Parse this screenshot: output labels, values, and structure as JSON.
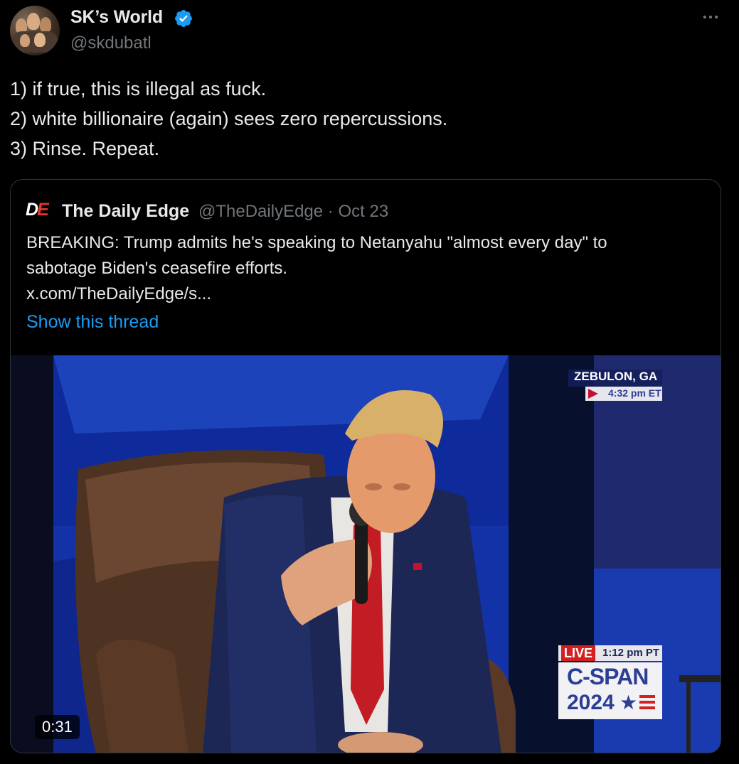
{
  "author": {
    "display_name": "SK’s World",
    "handle": "@skdubatl"
  },
  "tweet": {
    "lines": [
      "1) if true, this is illegal as fuck.",
      "2) white billionaire (again) sees zero repercussions.",
      "3) Rinse. Repeat."
    ]
  },
  "quote": {
    "logo_d": "D",
    "logo_e": "E",
    "name": "The Daily Edge",
    "handle": "@TheDailyEdge",
    "separator": "·",
    "date": "Oct 23",
    "lines": [
      "BREAKING: Trump admits he's speaking to Netanyahu \"almost every day\" to",
      "sabotage Biden's ceasefire efforts.",
      " x.com/TheDailyEdge/s..."
    ],
    "show_thread": "Show this thread"
  },
  "video": {
    "duration": "0:31",
    "location": "ZEBULON, GA",
    "local_time": "4:32 pm ET",
    "live_label": "LIVE",
    "live_time": "1:12 pm PT",
    "network": "C-SPAN",
    "network_year": "2024"
  },
  "colors": {
    "background": "#000000",
    "text": "#e7e9ea",
    "muted": "#71767b",
    "link": "#1d9bf0",
    "verified": "#1d9bf0",
    "border": "#2f3336",
    "cspan_blue": "#2d3f95",
    "live_red": "#d42020"
  },
  "icons": {
    "verified": "verified-badge-icon",
    "more": "more-options-icon"
  }
}
